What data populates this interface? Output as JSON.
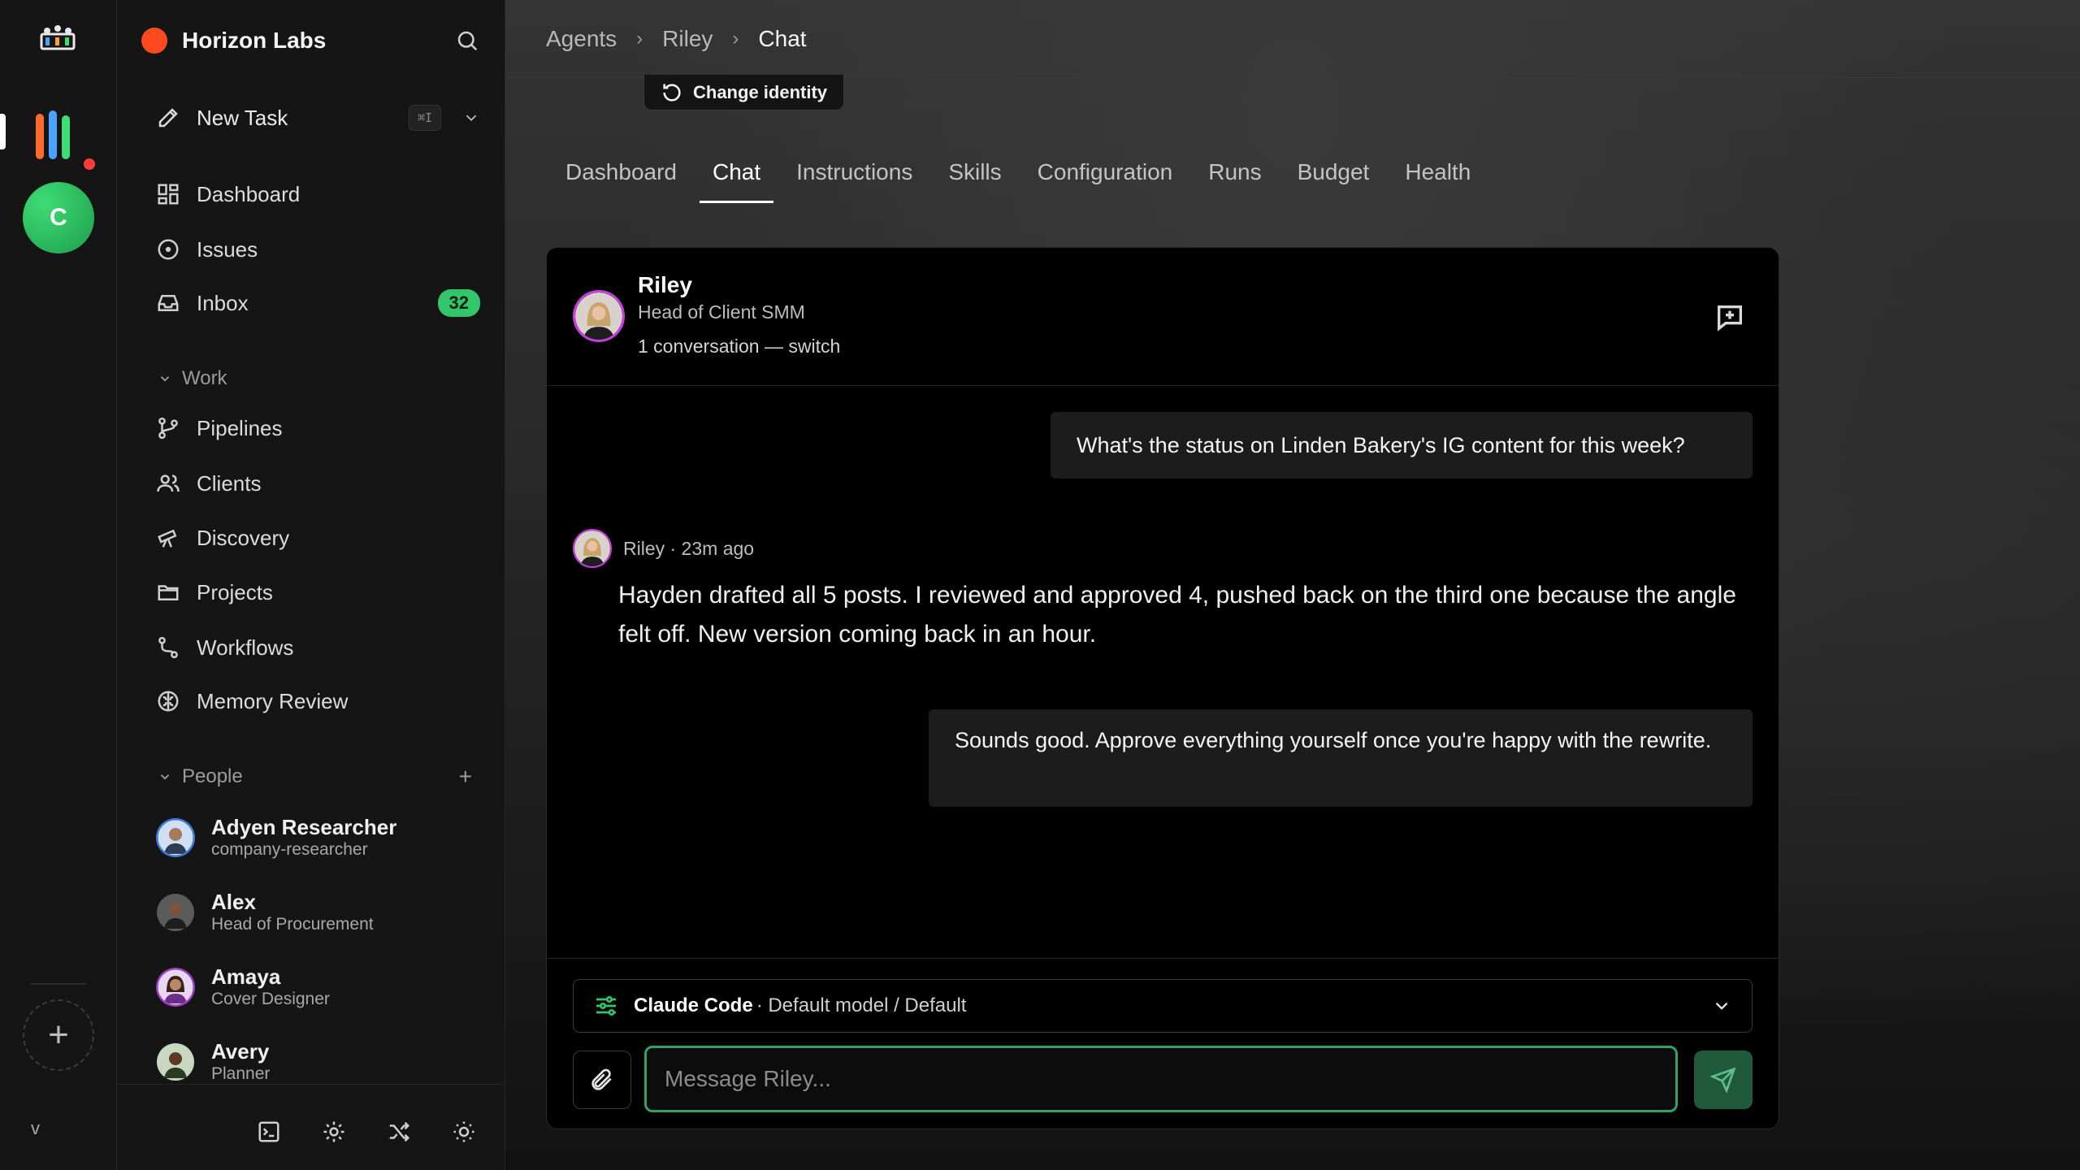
{
  "rail": {
    "company_initial": "C",
    "version": "v"
  },
  "sidebar": {
    "company_name": "Horizon Labs",
    "new_task": {
      "label": "New Task",
      "shortcut": "⌘I"
    },
    "nav": [
      {
        "label": "Dashboard",
        "icon": "dashboard-icon"
      },
      {
        "label": "Issues",
        "icon": "issues-icon"
      },
      {
        "label": "Inbox",
        "icon": "inbox-icon",
        "badge": "32"
      }
    ],
    "work_section": {
      "title": "Work",
      "items": [
        {
          "label": "Pipelines",
          "icon": "pipelines-icon"
        },
        {
          "label": "Clients",
          "icon": "clients-icon"
        },
        {
          "label": "Discovery",
          "icon": "telescope-icon"
        },
        {
          "label": "Projects",
          "icon": "folder-icon"
        },
        {
          "label": "Workflows",
          "icon": "workflow-icon"
        },
        {
          "label": "Memory Review",
          "icon": "brain-icon"
        }
      ]
    },
    "people_section": {
      "title": "People",
      "items": [
        {
          "name": "Adyen Researcher",
          "role": "company-researcher",
          "color": "#3a7bd5"
        },
        {
          "name": "Alex",
          "role": "Head of Procurement",
          "color": "#6b6b6b"
        },
        {
          "name": "Amaya",
          "role": "Cover Designer",
          "color": "#9c3fc4"
        },
        {
          "name": "Avery",
          "role": "Planner",
          "color": "#4a6a3a"
        }
      ]
    }
  },
  "breadcrumb": [
    "Agents",
    "Riley",
    "Chat"
  ],
  "identity_button": "Change identity",
  "tabs": [
    {
      "label": "Dashboard",
      "active": false
    },
    {
      "label": "Chat",
      "active": true
    },
    {
      "label": "Instructions",
      "active": false
    },
    {
      "label": "Skills",
      "active": false
    },
    {
      "label": "Configuration",
      "active": false
    },
    {
      "label": "Runs",
      "active": false
    },
    {
      "label": "Budget",
      "active": false
    },
    {
      "label": "Health",
      "active": false
    }
  ],
  "chat": {
    "agent_name": "Riley",
    "agent_role": "Head of Client SMM",
    "conversation_info": "1 conversation — switch",
    "messages": {
      "user_1": "What's the status on Linden Bakery's IG content for this week?",
      "agent_meta": "Riley · 23m ago",
      "agent_1": "Hayden drafted all 5 posts. I reviewed and approved 4, pushed back on the third one because the angle felt off. New version coming back in an hour.",
      "user_2": "Sounds good. Approve everything yourself once you're happy with the rewrite."
    },
    "model": {
      "name": "Claude Code",
      "detail": "· Default model / Default"
    },
    "input_placeholder": "Message Riley..."
  },
  "colors": {
    "accent_green": "#2ea36a",
    "badge_green": "#32c56a",
    "brand_orange": "#ff4a1f",
    "agent_ring": "#c93ee0"
  }
}
